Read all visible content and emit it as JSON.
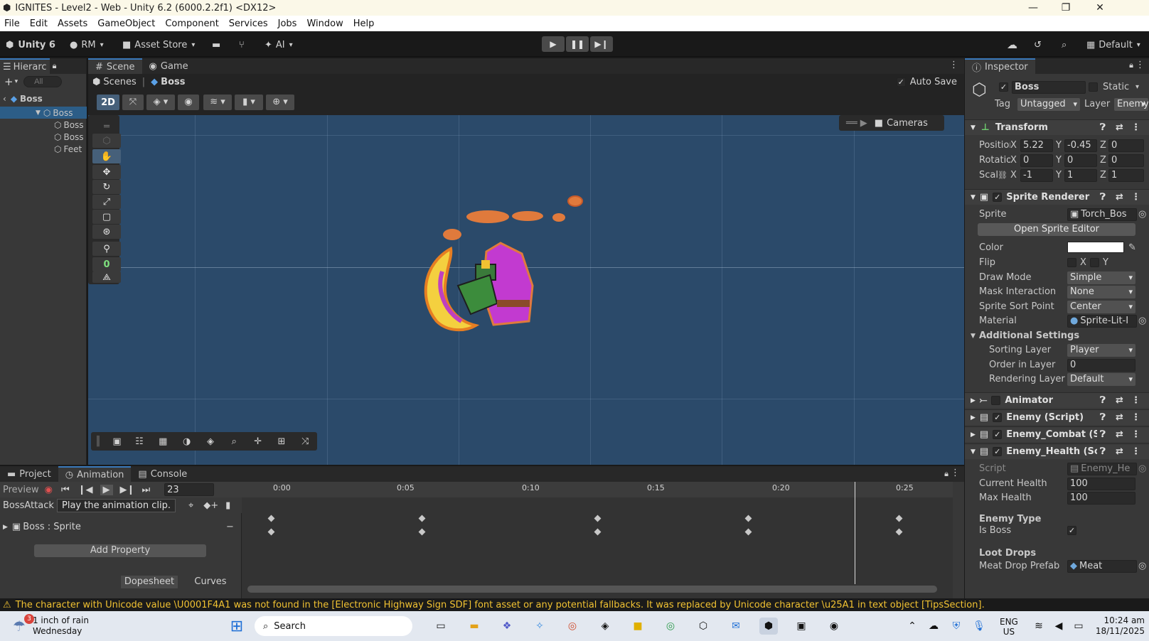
{
  "window": {
    "title": "IGNITES - Level2 - Web - Unity 6.2 (6000.2.2f1) <DX12>"
  },
  "menu": [
    "File",
    "Edit",
    "Assets",
    "GameObject",
    "Component",
    "Services",
    "Jobs",
    "Window",
    "Help"
  ],
  "toolbar": {
    "unity": "Unity 6",
    "account": "RM",
    "asset_store": "Asset Store",
    "ai": "AI",
    "layout": "Default"
  },
  "hierarchy": {
    "tab": "Hierarc",
    "search_placeholder": "All",
    "root": "Boss",
    "items": [
      "Boss",
      "Boss",
      "Boss",
      "Feet"
    ]
  },
  "scene": {
    "tabs": [
      "Scene",
      "Game"
    ],
    "breadcrumb": [
      "Scenes",
      "Boss"
    ],
    "auto_save": "Auto Save",
    "mode_2d": "2D",
    "cameras": "Cameras",
    "tool_counter": "0"
  },
  "inspector": {
    "tab": "Inspector",
    "object_name": "Boss",
    "static_label": "Static",
    "tag_label": "Tag",
    "tag": "Untagged",
    "layer_label": "Layer",
    "layer": "Enemy",
    "transform": {
      "title": "Transform",
      "position_label": "Position",
      "rotation_label": "Rotation",
      "scale_label": "Scale",
      "position": {
        "x": "5.22",
        "y": "-0.45",
        "z": "0"
      },
      "rotation": {
        "x": "0",
        "y": "0",
        "z": "0"
      },
      "scale": {
        "x": "-1",
        "y": "1",
        "z": "1"
      }
    },
    "sprite_renderer": {
      "title": "Sprite Renderer",
      "sprite_label": "Sprite",
      "sprite": "Torch_Bos",
      "open_editor": "Open Sprite Editor",
      "color_label": "Color",
      "color": "#ffffff",
      "flip_label": "Flip",
      "flip_x": "X",
      "flip_y": "Y",
      "draw_mode_label": "Draw Mode",
      "draw_mode": "Simple",
      "mask_label": "Mask Interaction",
      "mask": "None",
      "sort_point_label": "Sprite Sort Point",
      "sort_point": "Center",
      "material_label": "Material",
      "material": "Sprite-Lit-I",
      "additional": "Additional Settings",
      "sorting_layer_label": "Sorting Layer",
      "sorting_layer": "Player",
      "order_label": "Order in Layer",
      "order": "0",
      "rendering_label": "Rendering Layer M",
      "rendering": "Default"
    },
    "components": [
      "Animator",
      "Enemy (Script)",
      "Enemy_Combat (Scr",
      "Enemy_Health (Scrip"
    ],
    "health": {
      "script_label": "Script",
      "script": "Enemy_He",
      "current_label": "Current Health",
      "current": "100",
      "max_label": "Max Health",
      "max": "100",
      "type_header": "Enemy Type",
      "is_boss_label": "Is Boss",
      "loot_header": "Loot Drops",
      "meat_label": "Meat Drop Prefab",
      "meat": "Meat"
    }
  },
  "bottom": {
    "tabs": [
      "Project",
      "Animation",
      "Console"
    ],
    "preview": "Preview",
    "frame": "23",
    "clip": "BossAttack",
    "tooltip": "Play the animation clip.",
    "property": "Boss : Sprite",
    "add_property": "Add Property",
    "dopesheet": "Dopesheet",
    "curves": "Curves",
    "time_labels": [
      "0:00",
      "0:05",
      "0:10",
      "0:15",
      "0:20",
      "0:25"
    ]
  },
  "status": {
    "message": "The character with Unicode value \\U0001F4A1 was not found in the [Electronic Highway Sign SDF] font asset or any potential fallbacks. It was replaced by Unicode character \\u25A1 in text object [TipsSection]."
  },
  "taskbar": {
    "weather": "1 inch of rain",
    "day": "Wednesday",
    "badge": "3",
    "search": "Search",
    "lang": "ENG",
    "region": "US",
    "time": "10:24 am",
    "date": "18/11/2025"
  }
}
